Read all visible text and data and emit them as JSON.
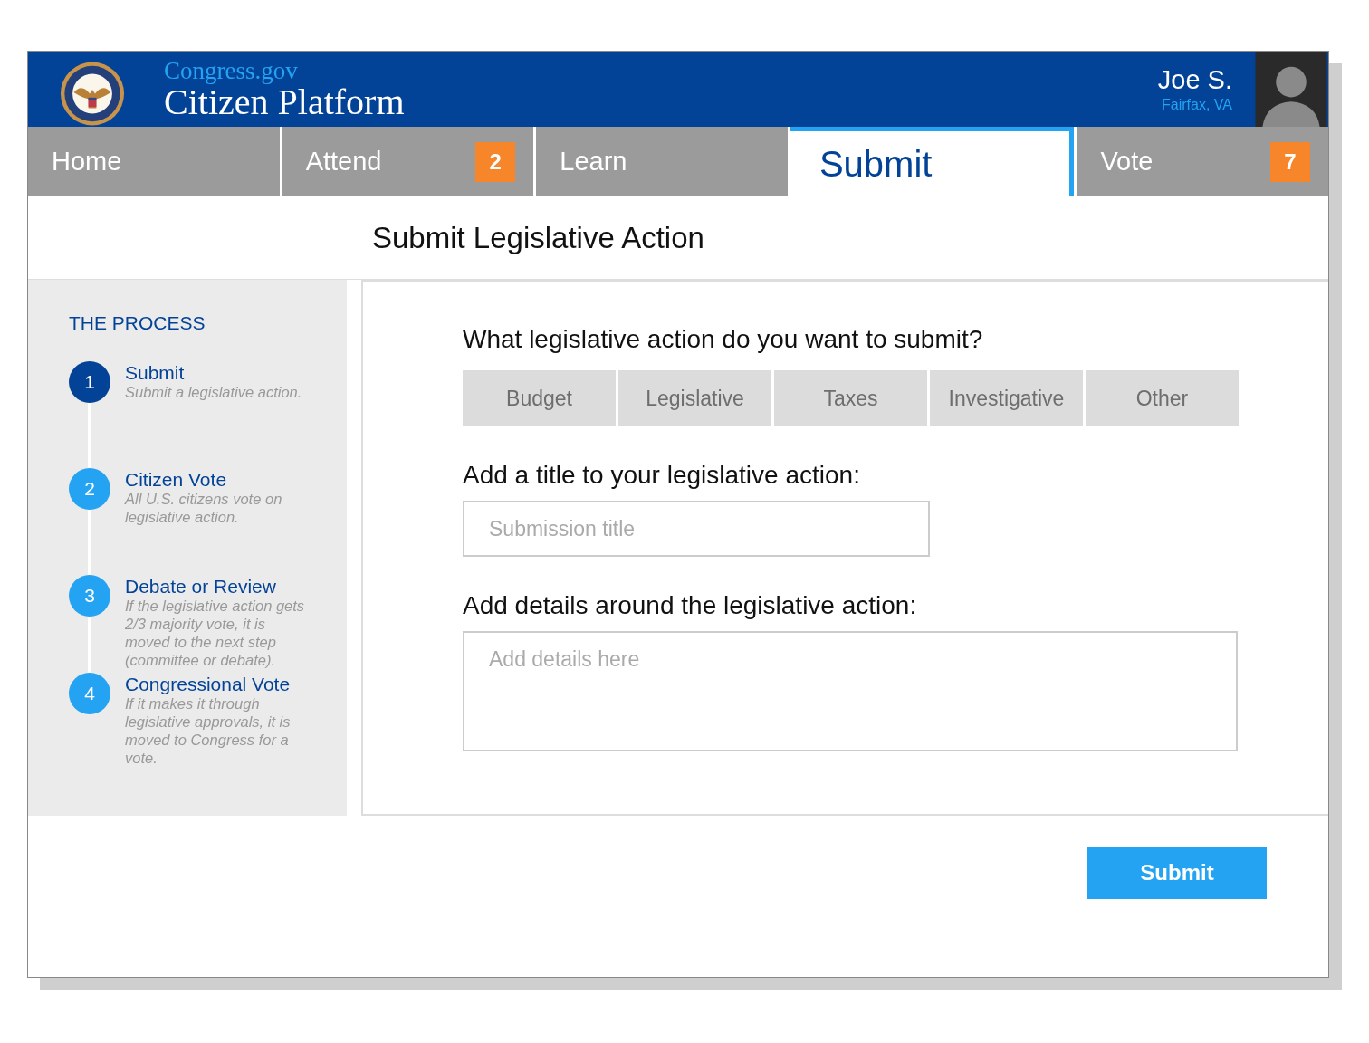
{
  "header": {
    "site": "Congress.gov",
    "title": "Citizen Platform",
    "user_name": "Joe S.",
    "user_location": "Fairfax, VA"
  },
  "tabs": [
    {
      "label": "Home",
      "selected": false
    },
    {
      "label": "Attend",
      "selected": false,
      "badge": "2"
    },
    {
      "label": "Learn",
      "selected": false
    },
    {
      "label": "Submit",
      "selected": true
    },
    {
      "label": "Vote",
      "selected": false,
      "badge": "7"
    }
  ],
  "page_title": "Submit Legislative Action",
  "process": {
    "heading": "THE PROCESS",
    "steps": [
      {
        "number": "1",
        "title": "Submit",
        "description": "Submit a legislative action.",
        "selected": true
      },
      {
        "number": "2",
        "title": "Citizen Vote",
        "description": "All U.S. citizens vote on legislative action.",
        "selected": false
      },
      {
        "number": "3",
        "title": "Debate or Review",
        "description": "If the legislative action gets 2/3 majority vote, it is moved to the next step (committee or debate).",
        "selected": false
      },
      {
        "number": "4",
        "title": "Congressional Vote",
        "description": "If it makes it through legislative approvals, it is moved to Congress for a vote.",
        "selected": false
      }
    ]
  },
  "form": {
    "type_question": "What legislative action do you want to submit?",
    "types": [
      {
        "label": "Budget",
        "selected": false
      },
      {
        "label": "Legislative",
        "selected": false
      },
      {
        "label": "Taxes",
        "selected": false
      },
      {
        "label": "Investigative",
        "selected": false
      },
      {
        "label": "Other",
        "selected": false
      }
    ],
    "title_label": "Add a title to your legislative action:",
    "title_placeholder": "Submission title",
    "details_label": "Add details around the legislative action:",
    "details_placeholder": "Add details here"
  },
  "submit_button": "Submit"
}
